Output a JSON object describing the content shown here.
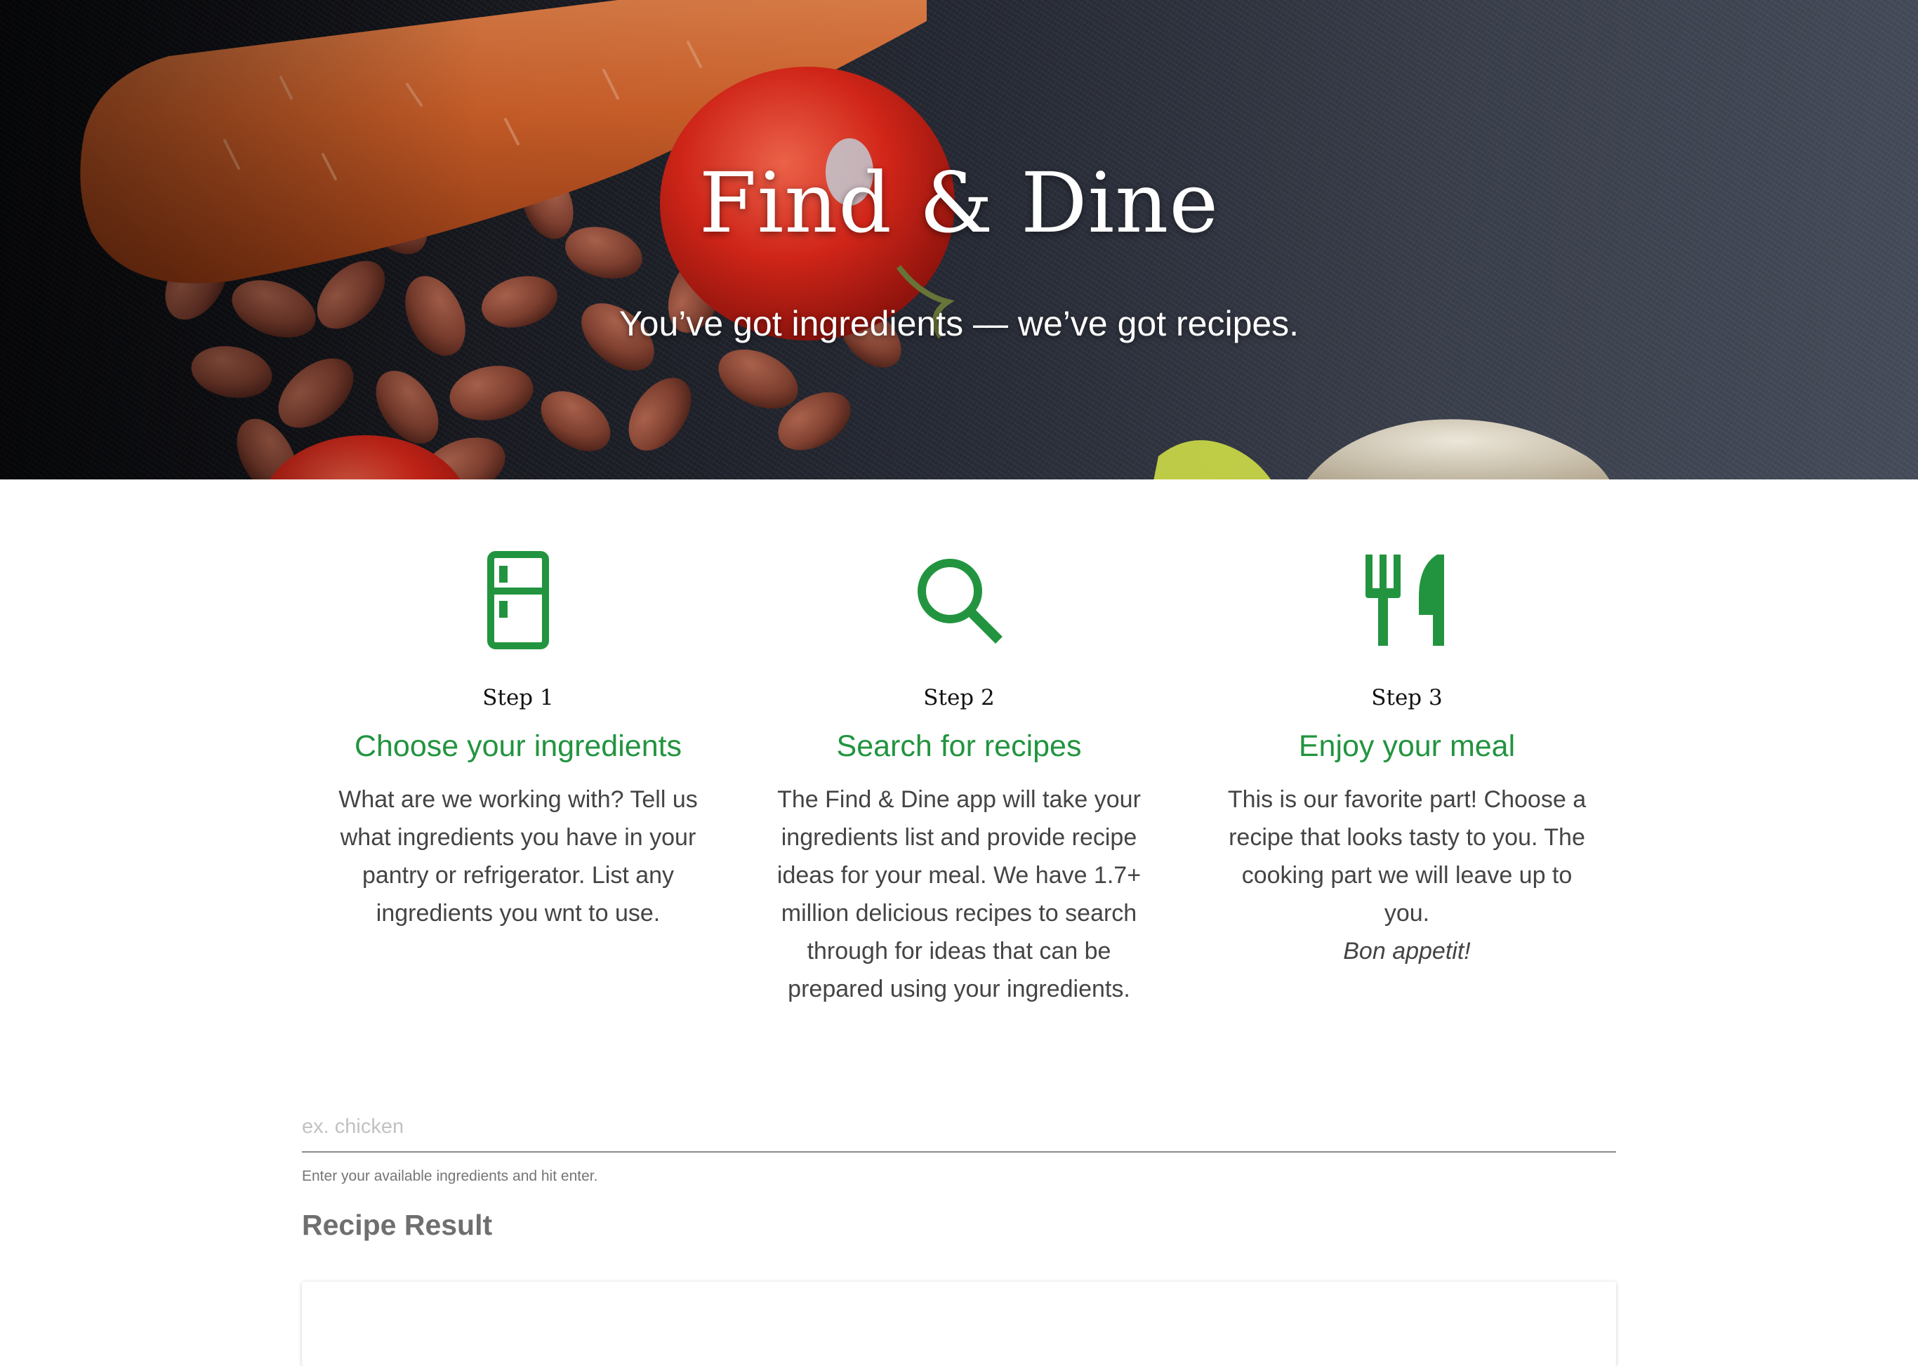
{
  "hero": {
    "title": "Find & Dine",
    "subtitle": "You’ve got ingredients — we’ve got recipes."
  },
  "steps": [
    {
      "number": "Step 1",
      "heading": "Choose your ingredients",
      "icon": "refrigerator-icon",
      "text": "What are we working with? Tell us what ingredients you have in your pantry or refrigerator. List any ingredients you wnt to use."
    },
    {
      "number": "Step 2",
      "heading": "Search for recipes",
      "icon": "search-icon",
      "text": "The Find & Dine app will take your ingredients list and provide recipe ideas for your meal. We have 1.7+ million delicious recipes to search through for ideas that can be prepared using your ingredients."
    },
    {
      "number": "Step 3",
      "heading": "Enjoy your meal",
      "icon": "fork-knife-icon",
      "text": "This is our favorite part! Choose a recipe that looks tasty to you. The cooking part we will leave up to you.",
      "emphasis": "Bon appetit!"
    }
  ],
  "search": {
    "value": "",
    "placeholder": "ex. chicken",
    "help": "Enter your available ingredients and hit enter."
  },
  "results": {
    "heading": "Recipe Result"
  },
  "colors": {
    "accent": "#22943f",
    "hero_text": "#ffffff",
    "body_text": "#444444",
    "muted_text": "#6f6f6f"
  }
}
